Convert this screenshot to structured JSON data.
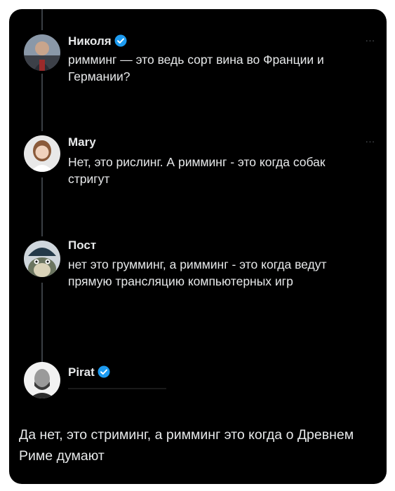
{
  "thread": [
    {
      "name": "Николя",
      "verified": true,
      "text": "римминг — это ведь сорт вина во Франции и Германии?",
      "more": "..."
    },
    {
      "name": "Mary",
      "verified": false,
      "text": "Нет, это рислинг. А римминг - это когда собак стригут",
      "more": "..."
    },
    {
      "name": "Пост",
      "verified": false,
      "text": "нет это грумминг, а римминг - это когда ведут прямую трансляцию компьютерных игр",
      "more": ""
    },
    {
      "name": "Pirat",
      "verified": true,
      "text": "",
      "more": ""
    }
  ],
  "final_text": "Да нет, это стриминг, а римминг это когда о Древнем Риме думают",
  "colors": {
    "background": "#000000",
    "text": "#e7e9ea",
    "verified": "#1d9bf0",
    "thread_line": "#3a3f44"
  }
}
